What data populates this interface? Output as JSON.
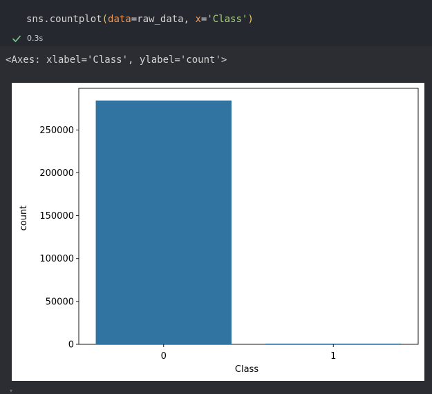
{
  "cell": {
    "code": {
      "func": "sns.countplot",
      "open_paren": "(",
      "kw1": "data",
      "eq1": "=",
      "arg1": "raw_data",
      "comma": ", ",
      "kw2": "x",
      "eq2": "=",
      "str2": "'Class'",
      "close_paren": ")"
    },
    "status": {
      "icon": "check-icon",
      "time": "0.3s",
      "color": "#7fcf8c"
    }
  },
  "output": {
    "repr": "<Axes: xlabel='Class', ylabel='count'>"
  },
  "chart_data": {
    "type": "bar",
    "categories": [
      "0",
      "1"
    ],
    "values": [
      284315,
      492
    ],
    "xlabel": "Class",
    "ylabel": "count",
    "ylim": [
      0,
      298530
    ],
    "yticks": [
      0,
      50000,
      100000,
      150000,
      200000,
      250000
    ],
    "ytick_labels": [
      "0",
      "50000",
      "100000",
      "150000",
      "200000",
      "250000"
    ],
    "bar_color": "#3274a1",
    "grid": false,
    "legend": "none"
  }
}
